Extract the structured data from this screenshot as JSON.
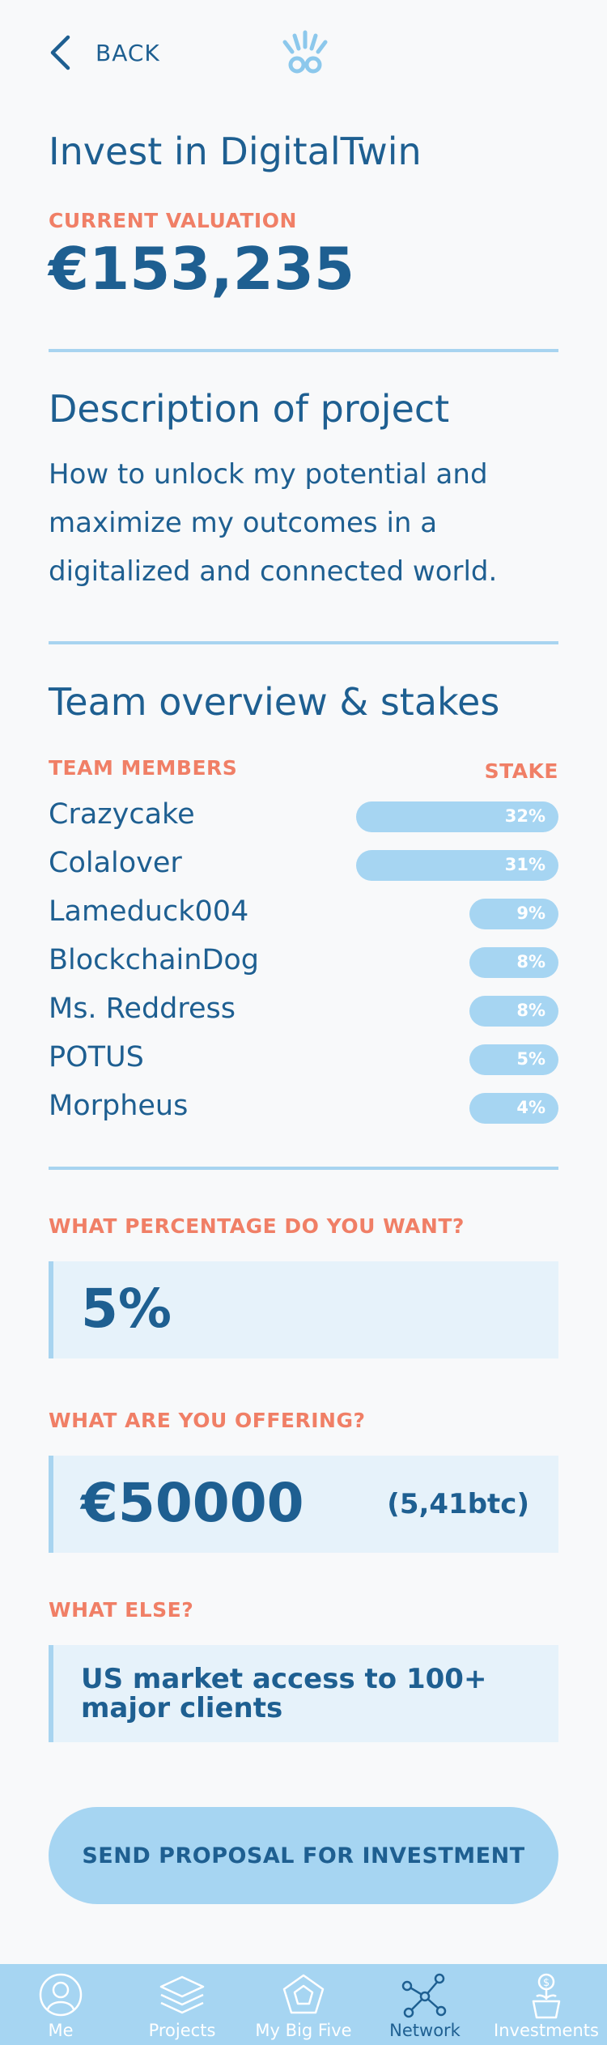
{
  "header": {
    "back_label": "BACK"
  },
  "title": "Invest in DigitalTwin",
  "valuation": {
    "label": "CURRENT VALUATION",
    "value": "€153,235"
  },
  "description": {
    "heading": "Description of project",
    "text": "How to unlock my potential and maximize my outcomes in a digitalized and connected world."
  },
  "team": {
    "heading": "Team overview & stakes",
    "members_label": "TEAM MEMBERS",
    "stake_label": "STAKE",
    "members": [
      {
        "name": "Crazycake",
        "stake": "32%",
        "stake_value": 32
      },
      {
        "name": "Colalover",
        "stake": "31%",
        "stake_value": 31
      },
      {
        "name": "Lameduck004",
        "stake": "9%",
        "stake_value": 9
      },
      {
        "name": "BlockchainDog",
        "stake": "8%",
        "stake_value": 8
      },
      {
        "name": "Ms. Reddress",
        "stake": "8%",
        "stake_value": 8
      },
      {
        "name": "POTUS",
        "stake": "5%",
        "stake_value": 5
      },
      {
        "name": "Morpheus",
        "stake": "4%",
        "stake_value": 4
      }
    ]
  },
  "form": {
    "percentage_label": "WHAT PERCENTAGE DO YOU WANT?",
    "percentage_value": "5%",
    "offering_label": "WHAT ARE YOU OFFERING?",
    "offering_value": "€50000",
    "offering_btc": "(5,41btc)",
    "else_label": "WHAT ELSE?",
    "else_value": "US market access to 100+ major clients"
  },
  "cta_label": "SEND PROPOSAL FOR INVESTMENT",
  "tabbar": {
    "active": "Network",
    "items": [
      {
        "label": "Me",
        "icon": "person-icon"
      },
      {
        "label": "Projects",
        "icon": "layers-icon"
      },
      {
        "label": "My Big Five",
        "icon": "pentagon-icon"
      },
      {
        "label": "Network",
        "icon": "network-icon"
      },
      {
        "label": "Investments",
        "icon": "plant-pot-icon"
      }
    ]
  },
  "colors": {
    "primary": "#1e5f91",
    "accent": "#f07f66",
    "light_blue": "#a6d5f2",
    "input_bg": "#e6f2fa",
    "background": "#f8f9fa"
  }
}
